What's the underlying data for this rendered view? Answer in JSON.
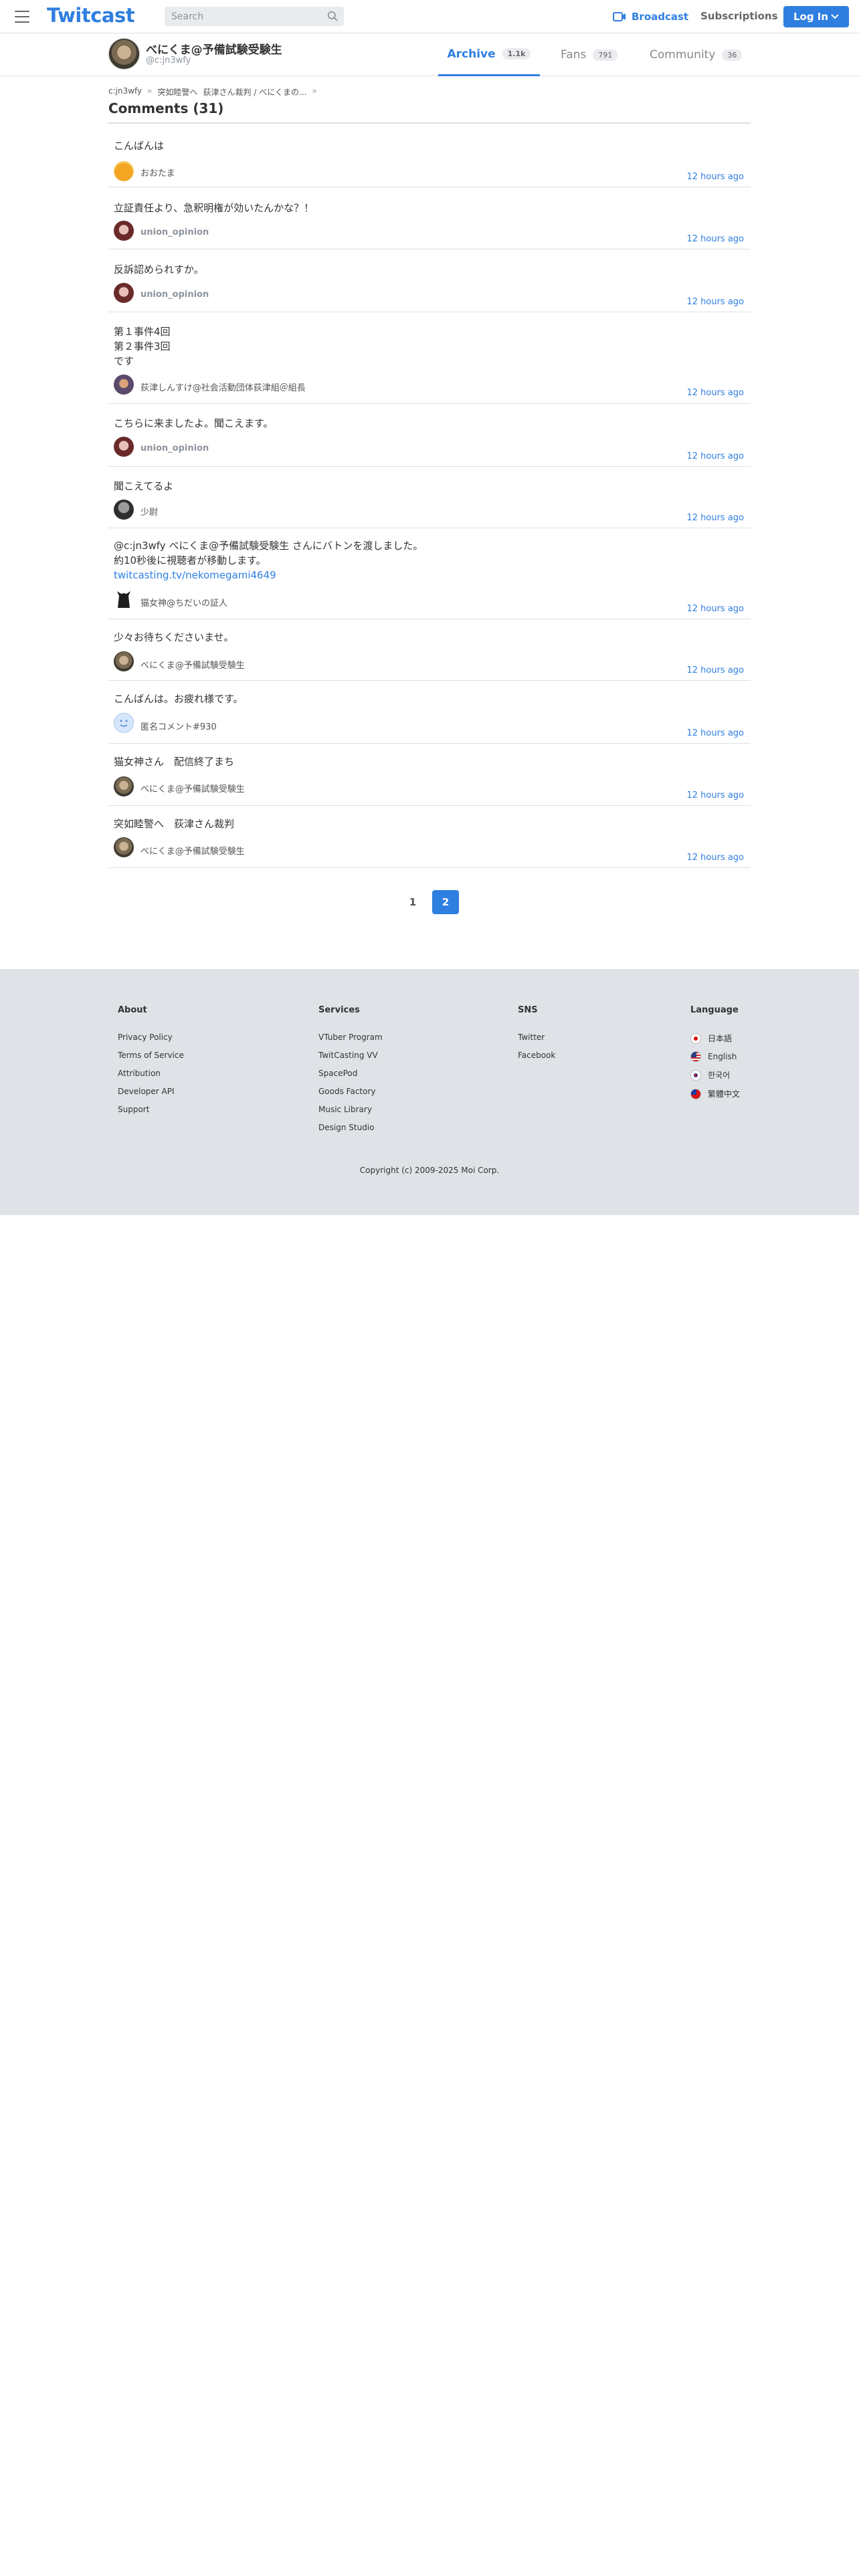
{
  "header": {
    "logo": "Twitcast",
    "search_placeholder": "Search",
    "broadcast_label": "Broadcast",
    "subscriptions_label": "Subscriptions",
    "login_label": "Log In"
  },
  "profile": {
    "name": "べにくま@予備試験受験生",
    "handle": "@c:jn3wfy",
    "tabs": [
      {
        "label": "Archive",
        "count": "1.1k"
      },
      {
        "label": "Fans",
        "count": "791"
      },
      {
        "label": "Community",
        "count": "36"
      }
    ]
  },
  "breadcrumb": {
    "items": [
      "c:jn3wfy",
      "突如睦警へ",
      "荻津さん裁判 / べにくまの..."
    ],
    "separator": "»"
  },
  "page_title": "Comments (31)",
  "comments": [
    {
      "text": "こんばんは",
      "user": "おおたま",
      "time": "12 hours ago"
    },
    {
      "text": "立証責任より、急釈明権が効いたんかな？！",
      "user": "union_opinion",
      "time": "12 hours ago"
    },
    {
      "text": "反訴認められすか。",
      "user": "union_opinion",
      "time": "12 hours ago"
    },
    {
      "text": "第１事件4回\n第２事件3回\nです",
      "user": "荻津しんすけ@社会活動団体荻津組＠組長",
      "time": "12 hours ago"
    },
    {
      "text": "こちらに来ましたよ。聞こえます。",
      "user": "union_opinion",
      "time": "12 hours ago"
    },
    {
      "text": "聞こえてるよ",
      "user": "少尉",
      "time": "12 hours ago"
    },
    {
      "text": "@c:jn3wfy べにくま@予備試験受験生 さんにバトンを渡しました。\n約10秒後に視聴者が移動します。",
      "link": "twitcasting.tv/nekomegami4649",
      "user": "猫女神@ちだいの証人",
      "time": "12 hours ago"
    },
    {
      "text": "少々お待ちくださいませ。",
      "user": "べにくま@予備試験受験生",
      "time": "12 hours ago"
    },
    {
      "text": "こんばんは。お疲れ様です。",
      "user": "匿名コメント#930",
      "time": "12 hours ago"
    },
    {
      "text": "猫女神さん　配信終了まち",
      "user": "べにくま@予備試験受験生",
      "time": "12 hours ago"
    },
    {
      "text": "突如睦警へ　荻津さん裁判",
      "user": "べにくま@予備試験受験生",
      "time": "12 hours ago"
    }
  ],
  "pagination": {
    "pages": [
      "1",
      "2"
    ],
    "current": "2"
  },
  "footer": {
    "about": {
      "heading": "About",
      "links": [
        "Privacy Policy",
        "Terms of Service",
        "Attribution",
        "Developer API",
        "Support"
      ]
    },
    "services": {
      "heading": "Services",
      "links": [
        "VTuber Program",
        "TwitCasting VV",
        "SpacePod",
        "Goods Factory",
        "Music Library",
        "Design Studio"
      ]
    },
    "sns": {
      "heading": "SNS",
      "links": [
        "Twitter",
        "Facebook"
      ]
    },
    "language": {
      "heading": "Language",
      "links": [
        "日本語",
        "English",
        "한국어",
        "繁體中文"
      ]
    },
    "copyright": "Copyright (c) 2009-2025 Moi Corp."
  },
  "colors": {
    "accent": "#2f7fe0",
    "footer_bg": "#dfe2e6",
    "divider": "#dcdfe3"
  }
}
